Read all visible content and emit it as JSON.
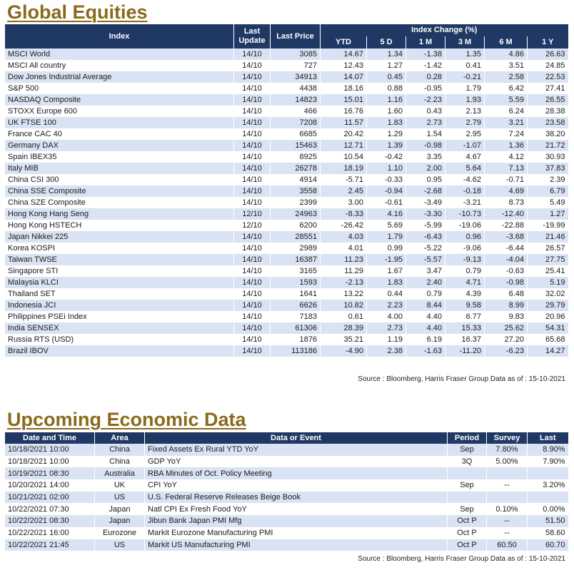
{
  "equities": {
    "title": "Global Equities",
    "headers": {
      "index": "Index",
      "last_update": "Last Update",
      "last_price": "Last Price",
      "index_change": "Index Change (%)",
      "ytd": "YTD",
      "d5": "5 D",
      "m1": "1 M",
      "m3": "3 M",
      "m6": "6 M",
      "y1": "1 Y"
    },
    "rows": [
      {
        "name": "MSCI World",
        "date": "14/10",
        "price": "3085",
        "ytd": "14.67",
        "d5": "1.34",
        "m1": "-1.38",
        "m3": "1.35",
        "m6": "4.86",
        "y1": "26.63"
      },
      {
        "name": "MSCI All country",
        "date": "14/10",
        "price": "727",
        "ytd": "12.43",
        "d5": "1.27",
        "m1": "-1.42",
        "m3": "0.41",
        "m6": "3.51",
        "y1": "24.85"
      },
      {
        "name": "Dow Jones Industrial Average",
        "date": "14/10",
        "price": "34913",
        "ytd": "14.07",
        "d5": "0.45",
        "m1": "0.28",
        "m3": "-0.21",
        "m6": "2.58",
        "y1": "22.53"
      },
      {
        "name": "S&P 500",
        "date": "14/10",
        "price": "4438",
        "ytd": "18.16",
        "d5": "0.88",
        "m1": "-0.95",
        "m3": "1.79",
        "m6": "6.42",
        "y1": "27.41"
      },
      {
        "name": "NASDAQ Composite",
        "date": "14/10",
        "price": "14823",
        "ytd": "15.01",
        "d5": "1.16",
        "m1": "-2.23",
        "m3": "1.93",
        "m6": "5.59",
        "y1": "26.55"
      },
      {
        "name": "STOXX Europe 600",
        "date": "14/10",
        "price": "466",
        "ytd": "16.76",
        "d5": "1.60",
        "m1": "0.43",
        "m3": "2.13",
        "m6": "6.24",
        "y1": "28.38"
      },
      {
        "name": "UK FTSE 100",
        "date": "14/10",
        "price": "7208",
        "ytd": "11.57",
        "d5": "1.83",
        "m1": "2.73",
        "m3": "2.79",
        "m6": "3.21",
        "y1": "23.58"
      },
      {
        "name": "France CAC 40",
        "date": "14/10",
        "price": "6685",
        "ytd": "20.42",
        "d5": "1.29",
        "m1": "1.54",
        "m3": "2.95",
        "m6": "7.24",
        "y1": "38.20"
      },
      {
        "name": "Germany DAX",
        "date": "14/10",
        "price": "15463",
        "ytd": "12.71",
        "d5": "1.39",
        "m1": "-0.98",
        "m3": "-1.07",
        "m6": "1.36",
        "y1": "21.72"
      },
      {
        "name": "Spain IBEX35",
        "date": "14/10",
        "price": "8925",
        "ytd": "10.54",
        "d5": "-0.42",
        "m1": "3.35",
        "m3": "4.67",
        "m6": "4.12",
        "y1": "30.93"
      },
      {
        "name": "Italy MIB",
        "date": "14/10",
        "price": "26278",
        "ytd": "18.19",
        "d5": "1.10",
        "m1": "2.00",
        "m3": "5.64",
        "m6": "7.13",
        "y1": "37.83"
      },
      {
        "name": "China CSI 300",
        "date": "14/10",
        "price": "4914",
        "ytd": "-5.71",
        "d5": "-0.33",
        "m1": "0.95",
        "m3": "-4.62",
        "m6": "-0.71",
        "y1": "2.39"
      },
      {
        "name": "China SSE Composite",
        "date": "14/10",
        "price": "3558",
        "ytd": "2.45",
        "d5": "-0.94",
        "m1": "-2.68",
        "m3": "-0.18",
        "m6": "4.69",
        "y1": "6.79"
      },
      {
        "name": "China SZE Composite",
        "date": "14/10",
        "price": "2399",
        "ytd": "3.00",
        "d5": "-0.61",
        "m1": "-3.49",
        "m3": "-3.21",
        "m6": "8.73",
        "y1": "5.49"
      },
      {
        "name": "Hong Kong Hang Seng",
        "date": "12/10",
        "price": "24963",
        "ytd": "-8.33",
        "d5": "4.16",
        "m1": "-3.30",
        "m3": "-10.73",
        "m6": "-12.40",
        "y1": "1.27"
      },
      {
        "name": "Hong Kong HSTECH",
        "date": "12/10",
        "price": "6200",
        "ytd": "-26.42",
        "d5": "5.69",
        "m1": "-5.99",
        "m3": "-19.06",
        "m6": "-22.88",
        "y1": "-19.99"
      },
      {
        "name": "Japan Nikkei 225",
        "date": "14/10",
        "price": "28551",
        "ytd": "4.03",
        "d5": "1.79",
        "m1": "-6.43",
        "m3": "0.96",
        "m6": "-3.68",
        "y1": "21.46"
      },
      {
        "name": "Korea KOSPI",
        "date": "14/10",
        "price": "2989",
        "ytd": "4.01",
        "d5": "0.99",
        "m1": "-5.22",
        "m3": "-9.06",
        "m6": "-6.44",
        "y1": "26.57"
      },
      {
        "name": "Taiwan TWSE",
        "date": "14/10",
        "price": "16387",
        "ytd": "11.23",
        "d5": "-1.95",
        "m1": "-5.57",
        "m3": "-9.13",
        "m6": "-4.04",
        "y1": "27.75"
      },
      {
        "name": "Singapore STI",
        "date": "14/10",
        "price": "3165",
        "ytd": "11.29",
        "d5": "1.67",
        "m1": "3.47",
        "m3": "0.79",
        "m6": "-0.63",
        "y1": "25.41"
      },
      {
        "name": "Malaysia KLCI",
        "date": "14/10",
        "price": "1593",
        "ytd": "-2.13",
        "d5": "1.83",
        "m1": "2.40",
        "m3": "4.71",
        "m6": "-0.98",
        "y1": "5.19"
      },
      {
        "name": "Thailand SET",
        "date": "14/10",
        "price": "1641",
        "ytd": "13.22",
        "d5": "0.44",
        "m1": "0.79",
        "m3": "4.39",
        "m6": "6.48",
        "y1": "32.02"
      },
      {
        "name": "Indonesia JCI",
        "date": "14/10",
        "price": "6626",
        "ytd": "10.82",
        "d5": "2.23",
        "m1": "8.44",
        "m3": "9.58",
        "m6": "8.99",
        "y1": "29.79"
      },
      {
        "name": "Philippines PSEi Index",
        "date": "14/10",
        "price": "7183",
        "ytd": "0.61",
        "d5": "4.00",
        "m1": "4.40",
        "m3": "6.77",
        "m6": "9.83",
        "y1": "20.96"
      },
      {
        "name": "India SENSEX",
        "date": "14/10",
        "price": "61306",
        "ytd": "28.39",
        "d5": "2.73",
        "m1": "4.40",
        "m3": "15.33",
        "m6": "25.62",
        "y1": "54.31"
      },
      {
        "name": "Russia RTS (USD)",
        "date": "14/10",
        "price": "1876",
        "ytd": "35.21",
        "d5": "1.19",
        "m1": "6.19",
        "m3": "16.37",
        "m6": "27.20",
        "y1": "65.68"
      },
      {
        "name": "Brazil IBOV",
        "date": "14/10",
        "price": "113186",
        "ytd": "-4.90",
        "d5": "2.38",
        "m1": "-1.63",
        "m3": "-11.20",
        "m6": "-6.23",
        "y1": "14.27"
      }
    ],
    "source": "Source : Bloomberg, Harris Fraser Group Data as of : 15-10-2021"
  },
  "economic": {
    "title": "Upcoming Economic Data",
    "headers": {
      "datetime": "Date and Time",
      "area": "Area",
      "event": "Data or Event",
      "period": "Period",
      "survey": "Survey",
      "last": "Last"
    },
    "rows": [
      {
        "datetime": "10/18/2021 10:00",
        "area": "China",
        "event": "Fixed Assets Ex Rural YTD YoY",
        "period": "Sep",
        "survey": "7.80%",
        "last": "8.90%"
      },
      {
        "datetime": "10/18/2021 10:00",
        "area": "China",
        "event": "GDP YoY",
        "period": "3Q",
        "survey": "5.00%",
        "last": "7.90%"
      },
      {
        "datetime": "10/19/2021 08:30",
        "area": "Australia",
        "event": "RBA Minutes of Oct. Policy Meeting",
        "period": "",
        "survey": "",
        "last": ""
      },
      {
        "datetime": "10/20/2021 14:00",
        "area": "UK",
        "event": "CPI YoY",
        "period": "Sep",
        "survey": "--",
        "last": "3.20%"
      },
      {
        "datetime": "10/21/2021 02:00",
        "area": "US",
        "event": "U.S. Federal Reserve Releases Beige Book",
        "period": "",
        "survey": "",
        "last": ""
      },
      {
        "datetime": "10/22/2021 07:30",
        "area": "Japan",
        "event": "Natl CPI Ex Fresh Food YoY",
        "period": "Sep",
        "survey": "0.10%",
        "last": "0.00%"
      },
      {
        "datetime": "10/22/2021 08:30",
        "area": "Japan",
        "event": "Jibun Bank Japan PMI Mfg",
        "period": "Oct P",
        "survey": "--",
        "last": "51.50"
      },
      {
        "datetime": "10/22/2021 16:00",
        "area": "Eurozone",
        "event": "Markit Eurozone Manufacturing PMI",
        "period": "Oct P",
        "survey": "--",
        "last": "58.60"
      },
      {
        "datetime": "10/22/2021 21:45",
        "area": "US",
        "event": "Markit US Manufacturing PMI",
        "period": "Oct P",
        "survey": "60.50",
        "last": "60.70"
      }
    ],
    "source": "Source : Bloomberg, Harris Fraser Group Data as of : 15-10-2021"
  }
}
